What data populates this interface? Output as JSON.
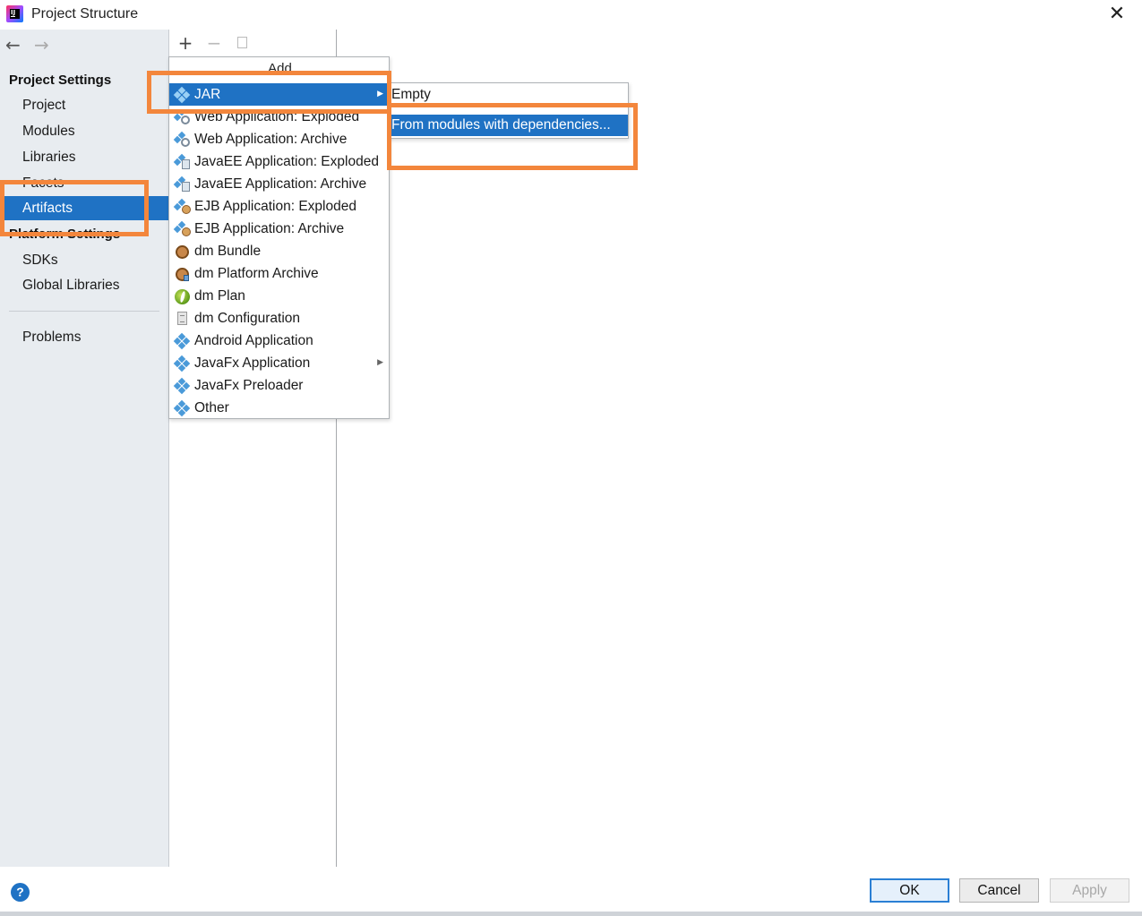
{
  "window": {
    "title": "Project Structure",
    "close_glyph": "✕"
  },
  "nav": {
    "back_glyph": "←",
    "forward_glyph": "→"
  },
  "sidebar": {
    "project_settings_header": "Project Settings",
    "project_settings_items": [
      "Project",
      "Modules",
      "Libraries",
      "Facets",
      "Artifacts"
    ],
    "selected_item": "Artifacts",
    "platform_settings_header": "Platform Settings",
    "platform_settings_items": [
      "SDKs",
      "Global Libraries"
    ],
    "other_items": [
      "Problems"
    ]
  },
  "toolbar": {
    "add_glyph": "+",
    "remove_glyph": "−",
    "copy_icon": "copy-icon"
  },
  "add_menu": {
    "title": "Add",
    "items": [
      {
        "label": "JAR",
        "icon": "artifact-icon",
        "has_submenu": true,
        "selected": true
      },
      {
        "label": "Web Application: Exploded",
        "icon": "web-exploded-icon"
      },
      {
        "label": "Web Application: Archive",
        "icon": "web-archive-icon"
      },
      {
        "label": "JavaEE Application: Exploded",
        "icon": "javaee-exploded-icon"
      },
      {
        "label": "JavaEE Application: Archive",
        "icon": "javaee-archive-icon"
      },
      {
        "label": "EJB Application: Exploded",
        "icon": "ejb-exploded-icon"
      },
      {
        "label": "EJB Application: Archive",
        "icon": "ejb-archive-icon"
      },
      {
        "label": "dm Bundle",
        "icon": "dm-bundle-icon"
      },
      {
        "label": "dm Platform Archive",
        "icon": "dm-platform-archive-icon"
      },
      {
        "label": "dm Plan",
        "icon": "dm-plan-icon"
      },
      {
        "label": "dm Configuration",
        "icon": "dm-configuration-icon"
      },
      {
        "label": "Android Application",
        "icon": "artifact-icon"
      },
      {
        "label": "JavaFx Application",
        "icon": "artifact-icon",
        "has_submenu": true
      },
      {
        "label": "JavaFx Preloader",
        "icon": "artifact-icon"
      },
      {
        "label": "Other",
        "icon": "artifact-icon"
      }
    ],
    "submenu_arrow": "▶"
  },
  "jar_submenu": {
    "items": [
      "Empty",
      "From modules with dependencies..."
    ],
    "selected": "From modules with dependencies..."
  },
  "footer": {
    "help_label": "?",
    "ok_label": "OK",
    "cancel_label": "Cancel",
    "apply_label": "Apply"
  },
  "colors": {
    "selection": "#1f72c4",
    "highlight_annotation": "#f3863c",
    "sidebar_bg": "#e8ecf0"
  }
}
